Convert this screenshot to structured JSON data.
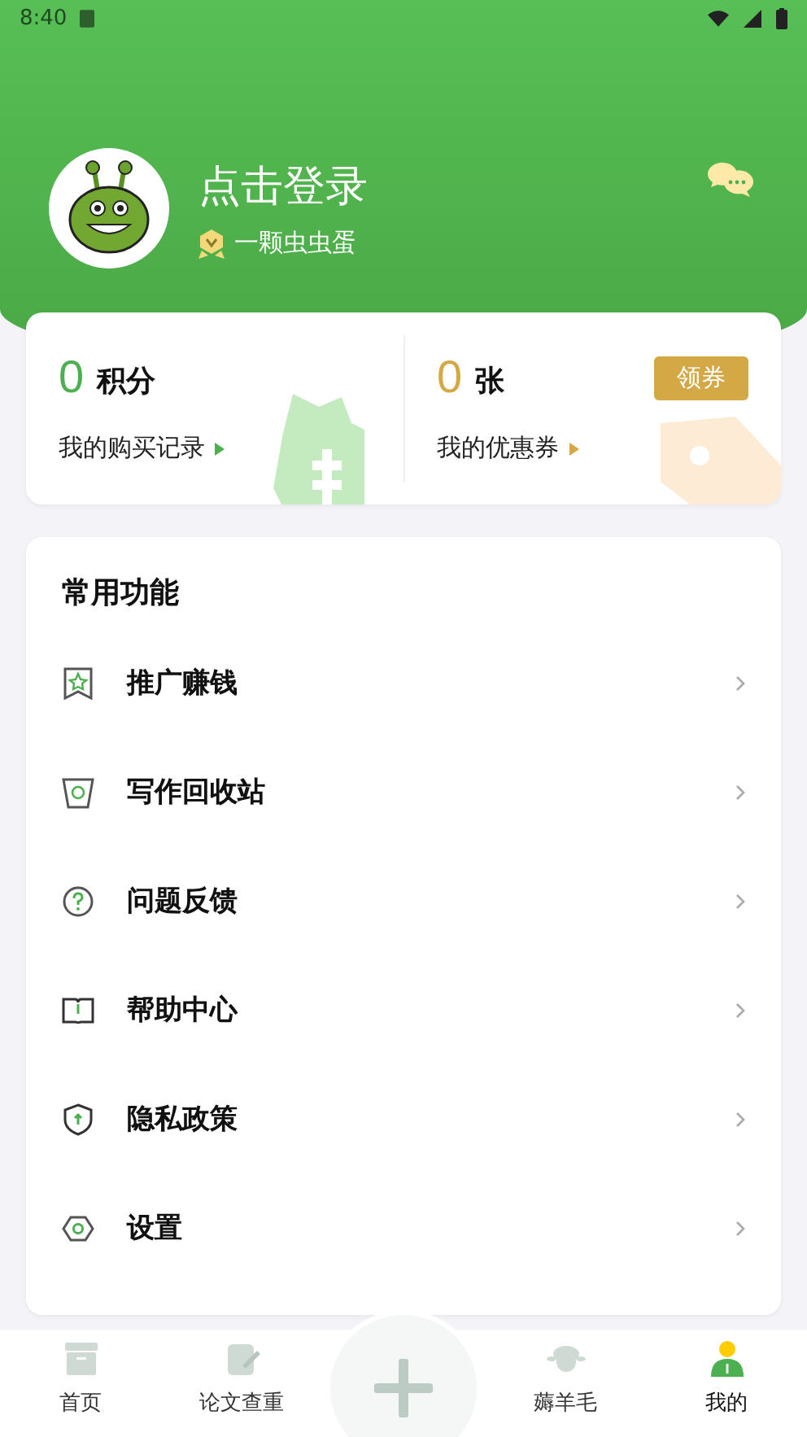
{
  "status_bar": {
    "time": "8:40"
  },
  "profile": {
    "name": "点击登录",
    "level": "一颗虫虫蛋"
  },
  "stats": [
    {
      "kind": "points",
      "value": "0",
      "unit": "积分",
      "link": "我的购买记录",
      "color": "#4caf50"
    },
    {
      "kind": "coupons",
      "value": "0",
      "unit": "张",
      "link": "我的优惠券",
      "color": "#d4a845",
      "button": "领券"
    }
  ],
  "menu": {
    "title": "常用功能",
    "items": [
      {
        "kind": "bookmark",
        "label": "推广赚钱"
      },
      {
        "kind": "bin",
        "label": "写作回收站"
      },
      {
        "kind": "question",
        "label": "问题反馈"
      },
      {
        "kind": "book",
        "label": "帮助中心"
      },
      {
        "kind": "shield",
        "label": "隐私政策"
      },
      {
        "kind": "hexagon",
        "label": "设置"
      }
    ]
  },
  "nav": [
    {
      "kind": "home",
      "label": "首页",
      "selected": false
    },
    {
      "kind": "paper",
      "label": "论文查重",
      "selected": false
    },
    {
      "kind": "plus"
    },
    {
      "kind": "sheep",
      "label": "薅羊毛",
      "selected": false
    },
    {
      "kind": "person",
      "label": "我的",
      "selected": true
    }
  ]
}
